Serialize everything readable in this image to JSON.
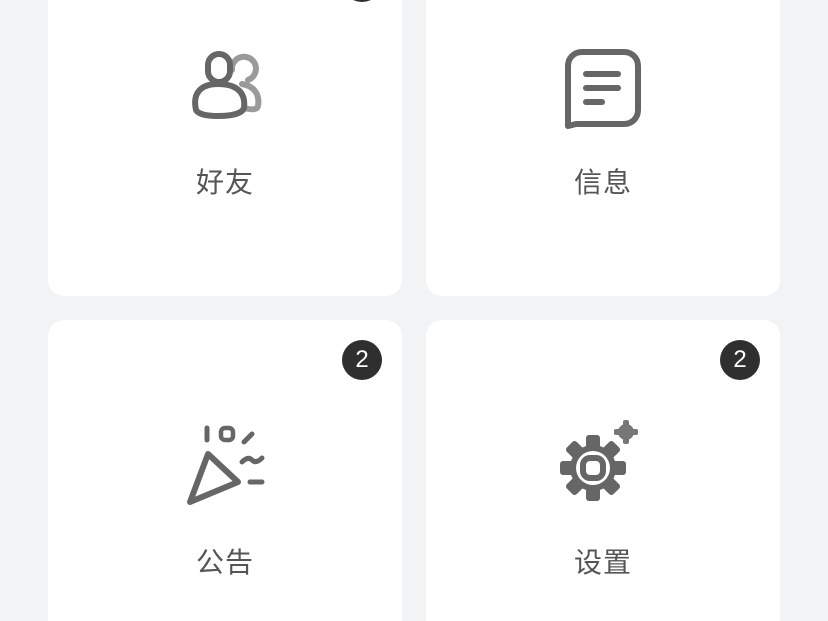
{
  "cards": [
    {
      "label": "好友",
      "icon": "friends-icon"
    },
    {
      "label": "信息",
      "icon": "message-icon"
    },
    {
      "label": "公告",
      "icon": "party-popper-icon",
      "badge": "2"
    },
    {
      "label": "设置",
      "icon": "gear-icon",
      "badge": "2"
    }
  ],
  "colors": {
    "background": "#f1f3f5",
    "card": "#ffffff",
    "icon": "#666666",
    "badge": "#2f2f2f",
    "label": "#555555"
  }
}
